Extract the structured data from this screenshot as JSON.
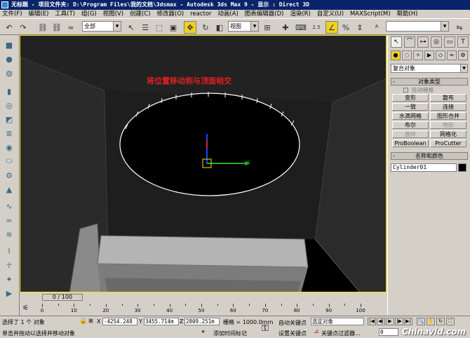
{
  "window": {
    "title": "无标题    - 项目文件夹: D:\\Program Files\\我的文档\\3dsmax    - Autodesk 3ds Max 9    - 显示 : Direct 3D"
  },
  "menu": [
    "文件(F)",
    "编辑(E)",
    "工具(T)",
    "组(G)",
    "视图(V)",
    "创建(C)",
    "修改器(O)",
    "reactor",
    "动画(A)",
    "图表编辑器(D)",
    "渲染(R)",
    "自定义(U)",
    "MAXScript(M)",
    "帮助(H)"
  ],
  "toolbar": {
    "selection_filter": "全部",
    "reference_coord": "视图",
    "percent_snap_label": "2.5",
    "named_selection": ""
  },
  "viewport": {
    "annotation": "将位置移动到与顶面相交",
    "axis_label": "y",
    "annotation_color": "#e02020",
    "active_border_color": "#ffde00"
  },
  "command_panel": {
    "category": "复合对象",
    "object_type_header": "对象类型",
    "autogrid": "自动栅格",
    "buttons": [
      "变形",
      "散布",
      "一致",
      "连接",
      "水滴网格",
      "图形合并",
      "布尔",
      "地形",
      "放样",
      "网格化",
      "ProBoolean",
      "ProCutter"
    ],
    "disabled": [
      "地形",
      "放样"
    ],
    "name_color_header": "名称和颜色",
    "object_name": "Cylinder01",
    "object_color": "#000000"
  },
  "timeline": {
    "slider": "0 / 100",
    "ticks": [
      "0",
      "10",
      "20",
      "30",
      "40",
      "50",
      "60",
      "70",
      "80",
      "90",
      "100"
    ]
  },
  "status": {
    "selected": "选择了 1 个 对象",
    "prompt": "单击并拖动以选择并移动对象",
    "x_label": "X",
    "x_value": "-4254.248",
    "y_label": "Y",
    "y_value": "3455.714m",
    "z_label": "Z",
    "z_value": "2809.251m",
    "grid": "栅格 = 1000.0mm",
    "add_time_tag": "添加时间标记",
    "auto_key": "自动关键点",
    "set_key": "设置关键点",
    "key_filter_combo": "选定对象",
    "key_filters": "关键点过滤器...",
    "frame": "0"
  },
  "watermark": "Chinavid.com"
}
